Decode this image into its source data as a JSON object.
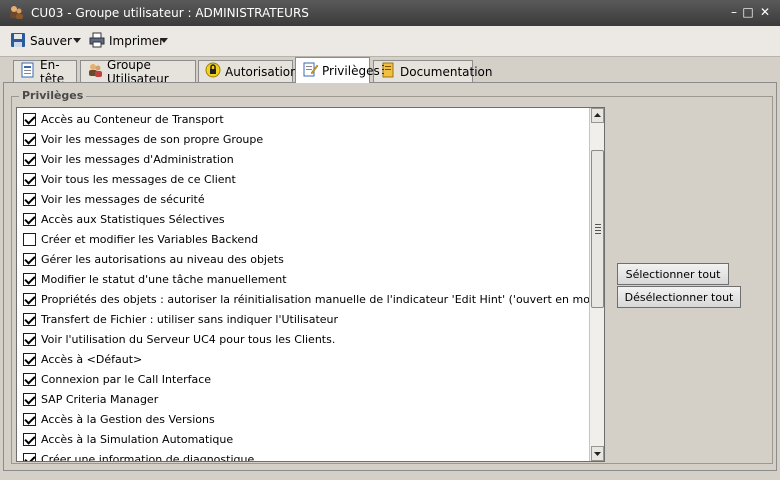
{
  "window": {
    "title": "CU03 - Groupe utilisateur : ADMINISTRATEURS",
    "minimize": "–",
    "maximize": "□",
    "close": "✕"
  },
  "toolbar": {
    "save_label": "Sauver",
    "print_label": "Imprimer"
  },
  "tabs": [
    {
      "label": "En-tête",
      "icon": "header-doc-icon"
    },
    {
      "label": "Groupe Utilisateur",
      "icon": "users-icon"
    },
    {
      "label": "Autorisations",
      "icon": "lock-icon"
    },
    {
      "label": "Privilèges",
      "icon": "pencil-doc-icon",
      "active": true
    },
    {
      "label": "Documentation",
      "icon": "notebook-icon"
    }
  ],
  "privileges": {
    "legend": "Privilèges",
    "items": [
      {
        "label": "Accès au Conteneur de Transport",
        "checked": true
      },
      {
        "label": "Voir les messages de son propre Groupe",
        "checked": true
      },
      {
        "label": "Voir les messages d'Administration",
        "checked": true
      },
      {
        "label": "Voir tous les messages de ce Client",
        "checked": true
      },
      {
        "label": "Voir les messages de sécurité",
        "checked": true
      },
      {
        "label": "Accès aux Statistiques Sélectives",
        "checked": true
      },
      {
        "label": "Créer et modifier les Variables Backend",
        "checked": false
      },
      {
        "label": "Gérer les autorisations au niveau des objets",
        "checked": true
      },
      {
        "label": "Modifier le statut d'une tâche manuellement",
        "checked": true
      },
      {
        "label": "Propriétés des objets : autoriser la réinitialisation manuelle de l'indicateur 'Edit Hint' ('ouvert en modification')",
        "checked": true
      },
      {
        "label": "Transfert de Fichier : utiliser sans indiquer l'Utilisateur",
        "checked": true
      },
      {
        "label": "Voir l'utilisation du Serveur UC4 pour tous les Clients.",
        "checked": true
      },
      {
        "label": "Accès à <Défaut>",
        "checked": true
      },
      {
        "label": "Connexion par le Call Interface",
        "checked": true
      },
      {
        "label": "SAP Criteria Manager",
        "checked": true
      },
      {
        "label": "Accès à la Gestion des Versions",
        "checked": true
      },
      {
        "label": "Accès à la Simulation Automatique",
        "checked": true
      },
      {
        "label": "Créer une information de diagnostique",
        "checked": true
      }
    ]
  },
  "buttons": {
    "select_all": "Sélectionner tout",
    "deselect_all": "Désélectionner tout"
  }
}
